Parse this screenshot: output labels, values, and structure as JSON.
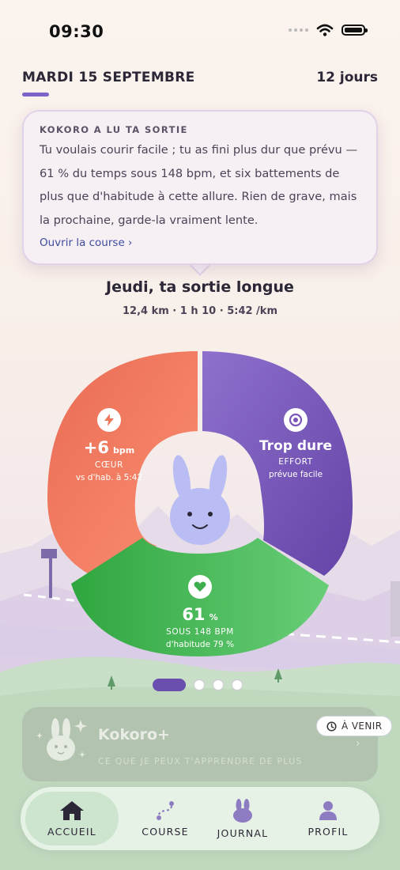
{
  "status_bar": {
    "time": "09:30"
  },
  "header": {
    "date": "MARDI 15 SEPTEMBRE",
    "streak": "12 jours"
  },
  "kokoro_card": {
    "kicker": "KOKORO A LU TA SORTIE",
    "message": "Tu voulais courir facile ; tu as fini plus dur que prévu — 61 % du temps sous 148 bpm, et six battements de plus que d'habitude à cette allure. Rien de grave, mais la prochaine, garde-la vraiment lente.",
    "link": "Ouvrir la course ›"
  },
  "run": {
    "title": "Jeudi, ta sortie longue",
    "meta": "12,4 km · 1 h 10 · 5:42 /km"
  },
  "segments": {
    "heart": {
      "value": "+6",
      "unit": "bpm",
      "label": "CŒUR",
      "note": "vs d'hab. à 5:42",
      "color": "#ef7a5e",
      "icon": "bolt-icon"
    },
    "effort": {
      "value": "Trop dure",
      "label": "EFFORT",
      "note": "prévue facile",
      "color": "#7a55b8",
      "icon": "target-icon"
    },
    "zone": {
      "value": "61",
      "unit": "%",
      "label": "SOUS 148 BPM",
      "note": "d'habitude 79 %",
      "color": "#3fae4c",
      "icon": "heart-icon"
    }
  },
  "pager": {
    "count": 4,
    "active": 0
  },
  "kokoro_plus": {
    "title": "Kokoro+",
    "subtitle": "CE QUE JE PEUX T'APPRENDRE DE PLUS",
    "badge": "À VENIR",
    "chevron": "›"
  },
  "nav": {
    "items": [
      {
        "label": "ACCUEIL",
        "icon": "home-icon",
        "active": true
      },
      {
        "label": "COURSE",
        "icon": "route-icon",
        "active": false
      },
      {
        "label": "JOURNAL",
        "icon": "bunny-icon",
        "active": false
      },
      {
        "label": "PROFIL",
        "icon": "person-icon",
        "active": false
      }
    ]
  },
  "colors": {
    "accent": "#7c63c9",
    "link": "#3e4e9e",
    "nav_bg": "#e7f2e6"
  }
}
